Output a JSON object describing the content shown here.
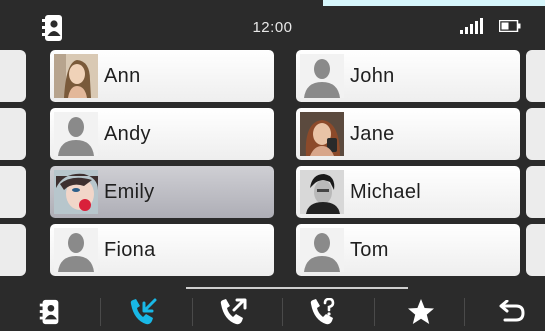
{
  "status_bar": {
    "time": "12:00",
    "icons": [
      "contacts-icon",
      "signal-icon",
      "battery-icon"
    ]
  },
  "contacts": {
    "left_column": [
      {
        "name": "Ann",
        "avatar": "photo",
        "selected": false
      },
      {
        "name": "Andy",
        "avatar": "silhouette",
        "selected": false
      },
      {
        "name": "Emily",
        "avatar": "photo",
        "selected": true
      },
      {
        "name": "Fiona",
        "avatar": "silhouette",
        "selected": false
      }
    ],
    "right_column": [
      {
        "name": "John",
        "avatar": "silhouette",
        "selected": false
      },
      {
        "name": "Jane",
        "avatar": "photo",
        "selected": false
      },
      {
        "name": "Michael",
        "avatar": "photo",
        "selected": false
      },
      {
        "name": "Tom",
        "avatar": "silhouette",
        "selected": false
      }
    ]
  },
  "bottom_nav": {
    "items": [
      {
        "icon": "contacts-icon",
        "active": false
      },
      {
        "icon": "incoming-call-icon",
        "active": true
      },
      {
        "icon": "outgoing-call-icon",
        "active": false
      },
      {
        "icon": "missed-call-icon",
        "active": false
      },
      {
        "icon": "star-icon",
        "active": false
      },
      {
        "icon": "back-icon",
        "active": false
      }
    ]
  },
  "colors": {
    "background": "#2b2b2b",
    "card": "#f4f4f4",
    "card_selected": "#b9b9c0",
    "accent": "#19b8e6",
    "icon": "#ffffff"
  }
}
